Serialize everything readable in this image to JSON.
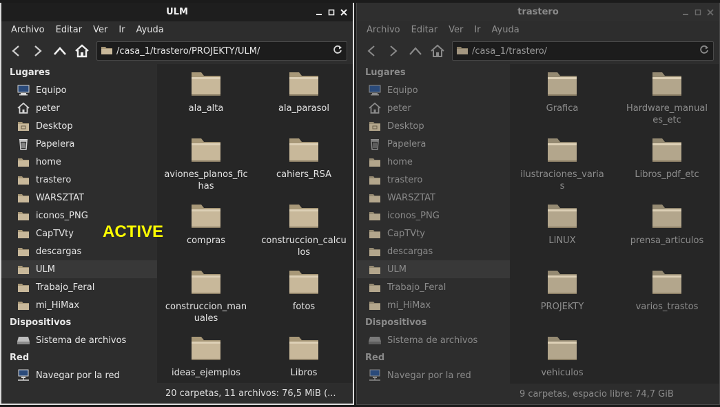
{
  "left_window": {
    "title": "ULM",
    "menu": [
      "Archivo",
      "Editar",
      "Ver",
      "Ir",
      "Ayuda"
    ],
    "path": "/casa_1/trastero/PROJEKTY/ULM/",
    "sidebar": {
      "places_header": "Lugares",
      "places": [
        {
          "label": "Equipo",
          "icon": "computer-icon"
        },
        {
          "label": "peter",
          "icon": "home-icon"
        },
        {
          "label": "Desktop",
          "icon": "desktop-folder-icon"
        },
        {
          "label": "Papelera",
          "icon": "trash-icon"
        },
        {
          "label": "home",
          "icon": "folder-icon"
        },
        {
          "label": "trastero",
          "icon": "folder-icon"
        },
        {
          "label": "WARSZTAT",
          "icon": "folder-icon"
        },
        {
          "label": "iconos_PNG",
          "icon": "folder-icon"
        },
        {
          "label": "CapTVty",
          "icon": "folder-icon"
        },
        {
          "label": "descargas",
          "icon": "folder-icon"
        },
        {
          "label": "ULM",
          "icon": "folder-icon",
          "selected": true
        },
        {
          "label": "Trabajo_Feral",
          "icon": "folder-icon"
        },
        {
          "label": "mi_HiMax",
          "icon": "folder-icon"
        }
      ],
      "devices_header": "Dispositivos",
      "devices": [
        {
          "label": "Sistema de archivos",
          "icon": "drive-icon"
        }
      ],
      "network_header": "Red",
      "network": [
        {
          "label": "Navegar por la red",
          "icon": "network-icon"
        }
      ]
    },
    "folders": [
      "ala_alta",
      "ala_parasol",
      "aviones_planos_fichas",
      "cahiers_RSA",
      "compras",
      "construccion_calculos",
      "construccion_manuales",
      "fotos",
      "ideas_ejemplos",
      "Libros"
    ],
    "status": "20 carpetas, 11 archivos: 76,5  MiB (..."
  },
  "overlay_label": "ACTIVE",
  "right_window": {
    "title": "trastero",
    "menu": [
      "Archivo",
      "Editar",
      "Ver",
      "Ir",
      "Ayuda"
    ],
    "path": "/casa_1/trastero/",
    "sidebar": {
      "places_header": "Lugares",
      "places": [
        {
          "label": "Equipo",
          "icon": "computer-icon"
        },
        {
          "label": "peter",
          "icon": "home-icon"
        },
        {
          "label": "Desktop",
          "icon": "desktop-folder-icon"
        },
        {
          "label": "Papelera",
          "icon": "trash-icon"
        },
        {
          "label": "home",
          "icon": "folder-icon"
        },
        {
          "label": "trastero",
          "icon": "folder-icon"
        },
        {
          "label": "WARSZTAT",
          "icon": "folder-icon"
        },
        {
          "label": "iconos_PNG",
          "icon": "folder-icon"
        },
        {
          "label": "CapTVty",
          "icon": "folder-icon"
        },
        {
          "label": "descargas",
          "icon": "folder-icon"
        },
        {
          "label": "ULM",
          "icon": "folder-icon",
          "selected": true
        },
        {
          "label": "Trabajo_Feral",
          "icon": "folder-icon"
        },
        {
          "label": "mi_HiMax",
          "icon": "folder-icon"
        }
      ],
      "devices_header": "Dispositivos",
      "devices": [
        {
          "label": "Sistema de archivos",
          "icon": "drive-icon"
        }
      ],
      "network_header": "Red",
      "network": [
        {
          "label": "Navegar por la red",
          "icon": "network-icon"
        }
      ]
    },
    "folders": [
      "Grafica",
      "Hardware_manuales_etc",
      "ilustraciones_varias",
      "Libros_pdf_etc",
      "LINUX",
      "prensa_articulos",
      "PROJEKTY",
      "varios_trastos",
      "vehiculos"
    ],
    "status": "9 carpetas, espacio libre: 74,7  GiB"
  },
  "colors": {
    "active_label": "#ffff00",
    "folder_body": "#c8b89a",
    "folder_tab": "#a89878"
  }
}
